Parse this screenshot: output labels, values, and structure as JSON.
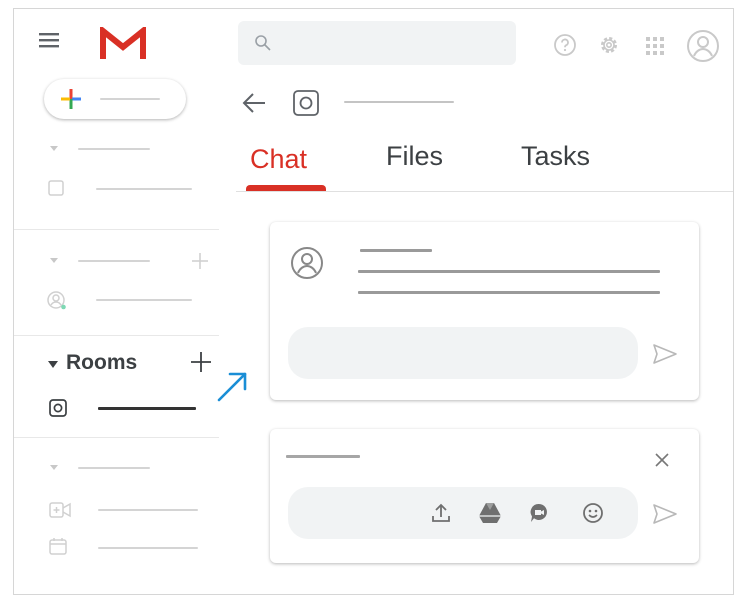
{
  "sidebar": {
    "compose_icon": "plus-colored-icon",
    "rooms": {
      "label": "Rooms"
    }
  },
  "header": {
    "search_placeholder": ""
  },
  "tabs": [
    {
      "label": "Chat",
      "active": true
    },
    {
      "label": "Files",
      "active": false
    },
    {
      "label": "Tasks",
      "active": false
    }
  ],
  "colors": {
    "gmail_red": "#d93025",
    "arrow_blue": "#1a8ed6",
    "icon_grey": "#9aa0a6"
  }
}
